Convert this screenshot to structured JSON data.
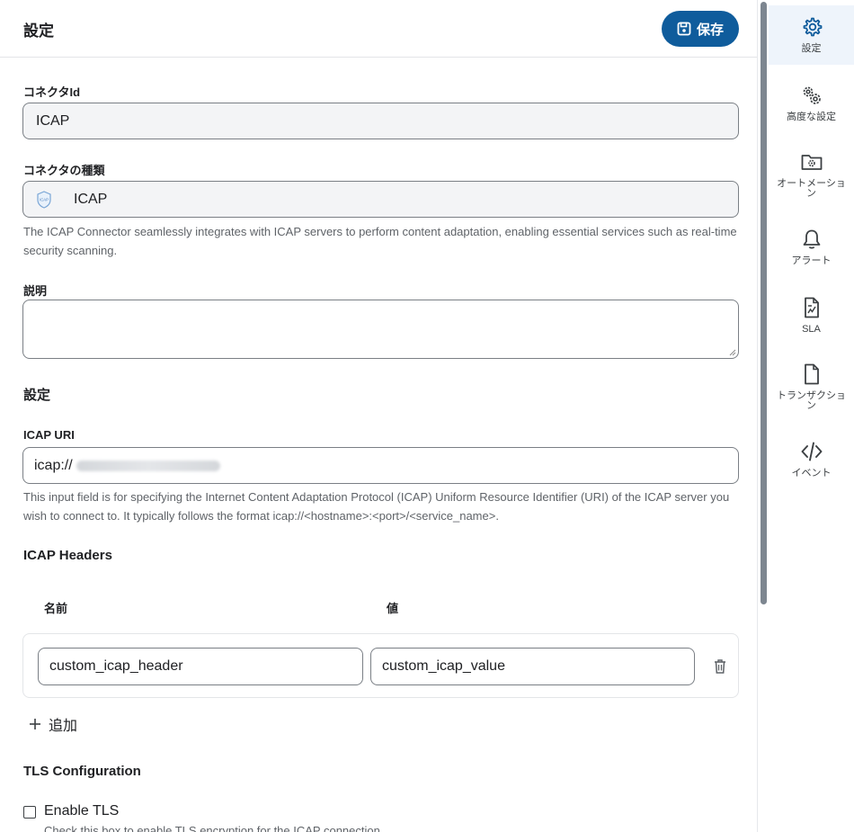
{
  "header": {
    "title": "設定",
    "save_label": "保存"
  },
  "form": {
    "connector_id": {
      "label": "コネクタId",
      "value": "ICAP"
    },
    "connector_type": {
      "label": "コネクタの種類",
      "value": "ICAP",
      "description": "The ICAP Connector seamlessly integrates with ICAP servers to perform content adaptation, enabling essential services such as real-time security scanning."
    },
    "description": {
      "label": "説明",
      "value": ""
    },
    "settings_title": "設定",
    "icap_uri": {
      "label": "ICAP URI",
      "value": "icap://",
      "help": "This input field is for specifying the Internet Content Adaptation Protocol (ICAP) Uniform Resource Identifier (URI) of the ICAP server you wish to connect to. It typically follows the format icap://<hostname>:<port>/<service_name>."
    },
    "icap_headers": {
      "title": "ICAP Headers",
      "name_col": "名前",
      "value_col": "値",
      "rows": [
        {
          "name": "custom_icap_header",
          "value": "custom_icap_value"
        }
      ],
      "add_label": "追加"
    },
    "tls": {
      "title": "TLS Configuration",
      "enable_label": "Enable TLS",
      "enable_checked": false,
      "enable_help": "Check this box to enable TLS encryption for the ICAP connection."
    }
  },
  "sidebar": {
    "items": [
      {
        "label": "設定",
        "icon": "gear-icon",
        "active": true
      },
      {
        "label": "高度な設定",
        "icon": "gears-icon",
        "active": false
      },
      {
        "label": "オートメーション",
        "icon": "folder-gear-icon",
        "active": false
      },
      {
        "label": "アラート",
        "icon": "bell-icon",
        "active": false
      },
      {
        "label": "SLA",
        "icon": "document-chart-icon",
        "active": false
      },
      {
        "label": "トランザクション",
        "icon": "document-icon",
        "active": false
      },
      {
        "label": "イベント",
        "icon": "code-icon",
        "active": false
      }
    ]
  },
  "colors": {
    "primary": "#0f5c9c",
    "active_nav_bg": "#eef4fb",
    "border": "#7a7f85"
  }
}
